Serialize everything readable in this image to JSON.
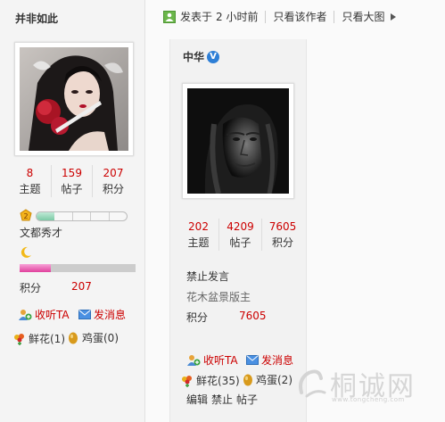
{
  "left_user": {
    "name": "并非如此",
    "stats": [
      {
        "value": "8",
        "label": "主题"
      },
      {
        "value": "159",
        "label": "帖子"
      },
      {
        "value": "207",
        "label": "积分"
      }
    ],
    "level_title": "文都秀才",
    "level_progress": 0.2,
    "magic_progress": 0.27,
    "points_label": "积分",
    "points_value": "207",
    "follow_label": "收听TA",
    "message_label": "发消息",
    "flower_label": "鲜花(1)",
    "egg_label": "鸡蛋(0)"
  },
  "post_header": {
    "posted_prefix": "发表于",
    "posted_time": "2 小时前",
    "author_only": "只看该作者",
    "large_image": "只看大图"
  },
  "right_user": {
    "name": "中华",
    "verified_badge": "V",
    "stats": [
      {
        "value": "202",
        "label": "主题"
      },
      {
        "value": "4209",
        "label": "帖子"
      },
      {
        "value": "7605",
        "label": "积分"
      }
    ],
    "status": "禁止发言",
    "role": "花木盆景版主",
    "points_label": "积分",
    "points_value": "7605",
    "follow_label": "收听TA",
    "message_label": "发消息",
    "flower_label": "鲜花(35)",
    "egg_label": "鸡蛋(2)",
    "admin_actions": [
      "编辑",
      "禁止",
      "帖子"
    ]
  },
  "watermark": {
    "text": "桐诚网",
    "url": "www.tongcheng.com"
  },
  "colors": {
    "accent_red": "#cc0000",
    "sidebar_bg": "#f4f4f4",
    "verified_blue": "#2e7fd6"
  }
}
